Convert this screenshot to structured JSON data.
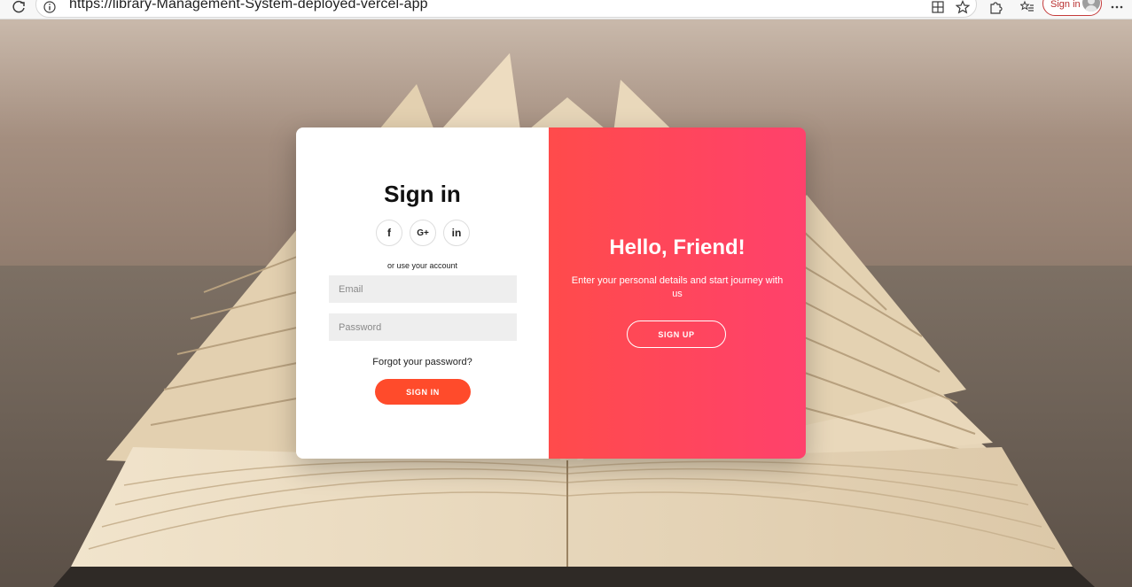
{
  "browser": {
    "url": "https://library-Management-System-deployed-vercel-app",
    "signin_label": "Sign in",
    "icons": [
      "reload-icon",
      "info-icon",
      "split-screen-icon",
      "favorite-star-icon",
      "extensions-icon",
      "favorites-icon",
      "profile-avatar-icon",
      "more-menu-icon"
    ]
  },
  "sign_in_panel": {
    "title": "Sign in",
    "social": [
      {
        "name": "facebook-icon",
        "glyph": "f"
      },
      {
        "name": "google-plus-icon",
        "glyph": "G+"
      },
      {
        "name": "linkedin-icon",
        "glyph": "in"
      }
    ],
    "hint": "or use your account",
    "email_placeholder": "Email",
    "password_placeholder": "Password",
    "forgot": "Forgot your password?",
    "button": "SIGN IN"
  },
  "sign_up_panel": {
    "title": "Hello, Friend!",
    "subtitle": "Enter your personal details and start journey with us",
    "button": "SIGN UP"
  },
  "colors": {
    "accent": "#ff4b2b",
    "overlay_start": "#ff4b4b",
    "overlay_end": "#ff416c"
  }
}
